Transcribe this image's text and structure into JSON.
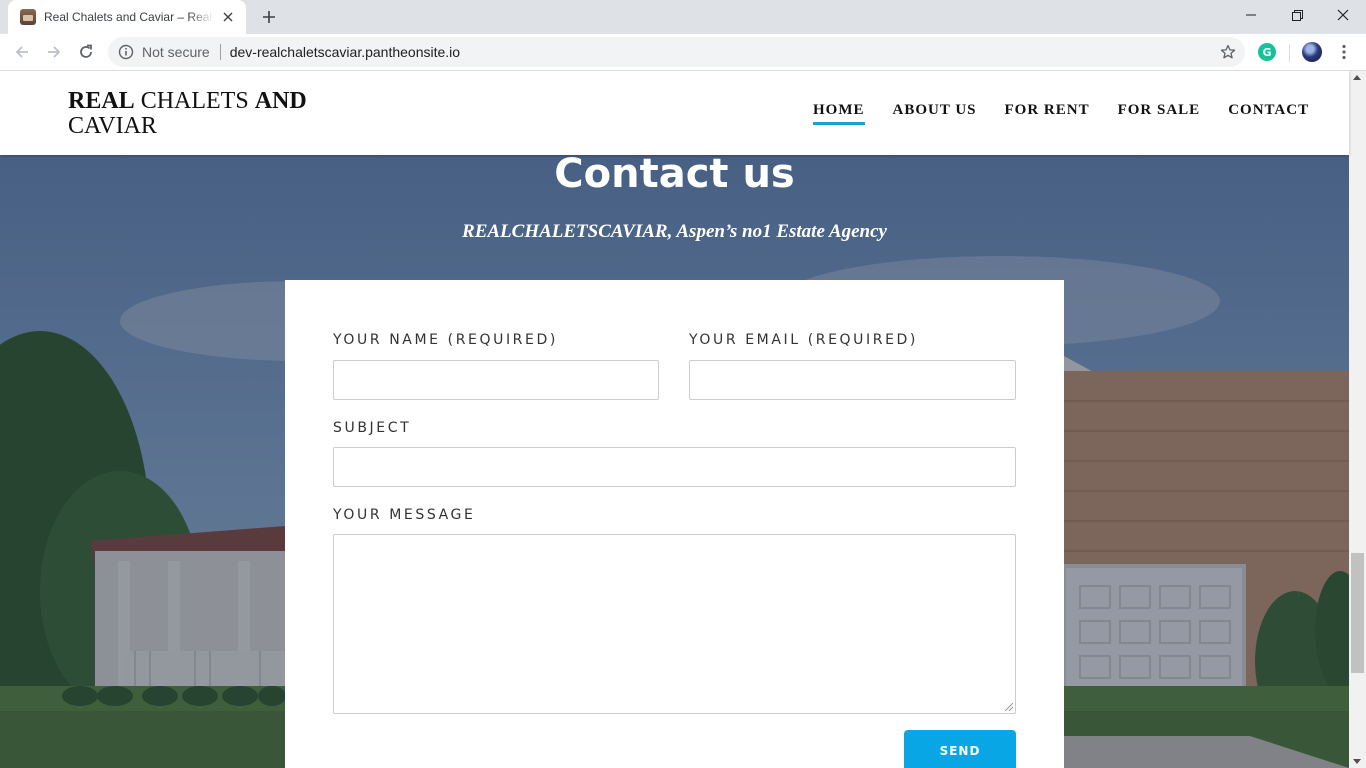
{
  "browser": {
    "tab_title": "Real Chalets and Caviar – Real Estate Agency",
    "security_label": "Not secure",
    "url": "dev-realchaletscaviar.pantheonsite.io",
    "grammarly_letter": "G"
  },
  "site": {
    "logo": {
      "part1": "REAL",
      "part2": " CHALETS ",
      "part3": "AND",
      "part4": "CAVIAR"
    },
    "nav": {
      "home": "HOME",
      "about": "ABOUT US",
      "rent": "FOR RENT",
      "sale": "FOR SALE",
      "contact": "CONTACT"
    },
    "active_nav": "HOME",
    "accent_color": "#1a9fd8"
  },
  "hero": {
    "title": "Contact us",
    "subtitle": "REALCHALETSCAVIAR,  Aspen’s no1 Estate Agency"
  },
  "form": {
    "name_label": "YOUR NAME (REQUIRED)",
    "email_label": "YOUR EMAIL (REQUIRED)",
    "subject_label": "SUBJECT",
    "message_label": "YOUR MESSAGE",
    "name_value": "",
    "email_value": "",
    "subject_value": "",
    "message_value": "",
    "send_label": "SEND",
    "send_color": "#08a6e4"
  }
}
